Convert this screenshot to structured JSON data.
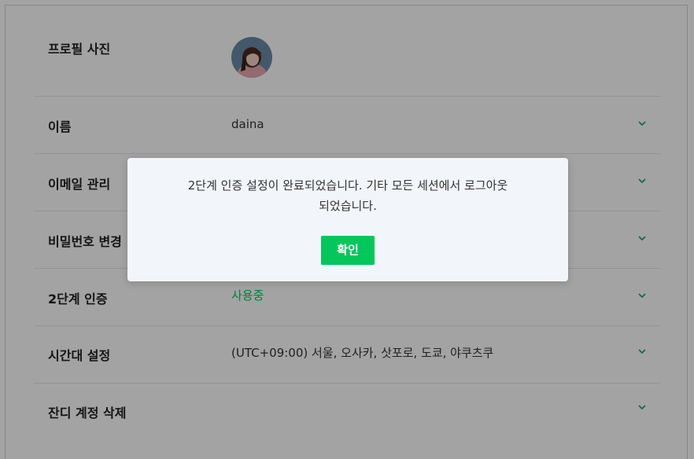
{
  "settings": {
    "profile_photo_label": "프로필 사진",
    "name_label": "이름",
    "name_value": "daina",
    "email_label": "이메일 관리",
    "password_label": "비밀번호 변경",
    "two_factor_label": "2단계 인증",
    "two_factor_value": "사용중",
    "timezone_label": "시간대 설정",
    "timezone_value": "(UTC+09:00) 서울, 오사카, 삿포로, 도쿄, 야쿠츠쿠",
    "delete_account_label": "잔디 계정 삭제"
  },
  "dialog": {
    "message_line1": "2단계 인증 설정이 완료되었습니다. 기타 모든 세션에서 로그아웃",
    "message_line2": "되었습니다.",
    "confirm_label": "확인"
  },
  "colors": {
    "accent": "#03c75a",
    "overlay": "rgba(0,0,0,0.36)"
  },
  "icons": {
    "row_toggle": "chevron-down-icon",
    "avatar": "profile-avatar"
  }
}
